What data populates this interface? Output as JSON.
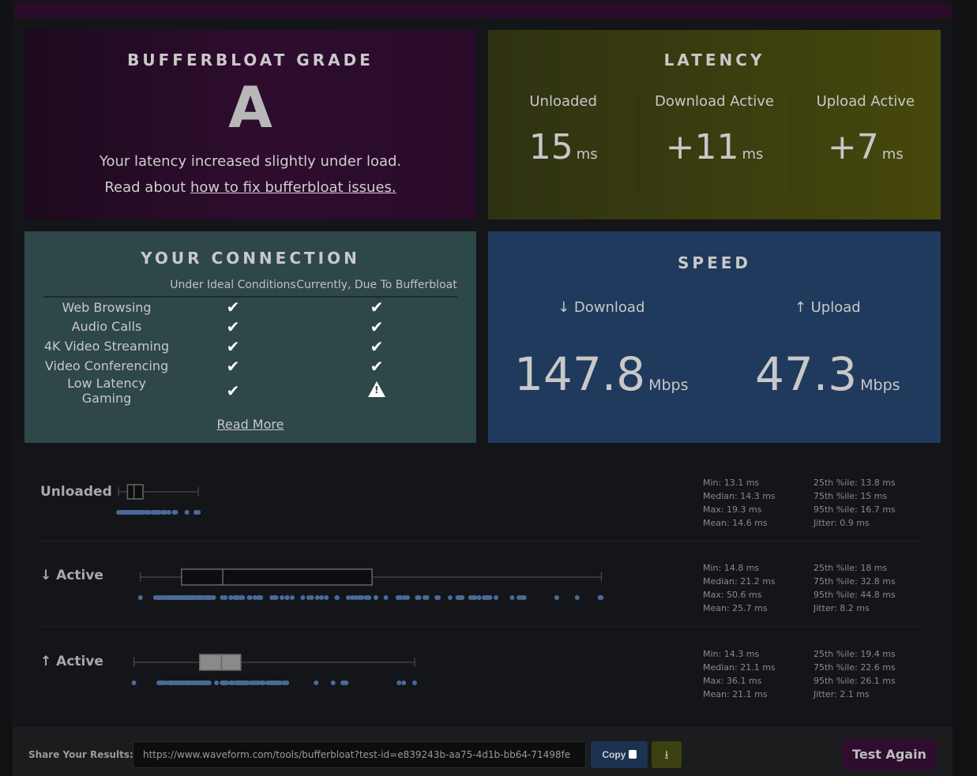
{
  "grade": {
    "title": "BUFFERBLOAT GRADE",
    "letter": "A",
    "line1": "Your latency increased slightly under load.",
    "line2_prefix": "Read about ",
    "link": "how to fix bufferbloat issues."
  },
  "latency": {
    "title": "LATENCY",
    "cols": [
      {
        "label": "Unloaded",
        "value": "15",
        "unit": "ms"
      },
      {
        "label": "Download Active",
        "value": "+11",
        "unit": "ms"
      },
      {
        "label": "Upload Active",
        "value": "+7",
        "unit": "ms"
      }
    ]
  },
  "connection": {
    "title": "YOUR CONNECTION",
    "col1": "Under Ideal Conditions",
    "col2": "Currently, Due To Bufferbloat",
    "rows": [
      {
        "name": "Web Browsing",
        "ideal": "ok",
        "current": "ok"
      },
      {
        "name": "Audio Calls",
        "ideal": "ok",
        "current": "ok"
      },
      {
        "name": "4K Video Streaming",
        "ideal": "ok",
        "current": "ok"
      },
      {
        "name": "Video Conferencing",
        "ideal": "ok",
        "current": "ok"
      },
      {
        "name": "Low Latency Gaming",
        "ideal": "ok",
        "current": "warning"
      }
    ],
    "read_more": "Read More"
  },
  "speed": {
    "title": "SPEED",
    "download_label": "↓ Download",
    "download": "147.8",
    "upload_label": "↑ Upload",
    "upload": "47.3",
    "unit": "Mbps"
  },
  "latency_rows": [
    {
      "label": "Unloaded",
      "min": 13.1,
      "median": 14.3,
      "max": 19.3,
      "mean": 14.6,
      "p25": 13.8,
      "p75": 15,
      "p95": 16.7,
      "jitter": 0.9,
      "s": [
        "Min: 13.1 ms",
        "Median: 14.3 ms",
        "Max: 19.3 ms",
        "Mean: 14.6 ms",
        "25th %ile: 13.8 ms",
        "75th %ile: 15 ms",
        "95th %ile: 16.7 ms",
        "Jitter: 0.9 ms"
      ]
    },
    {
      "label": "↓ Active",
      "min": 14.8,
      "median": 21.2,
      "max": 50.6,
      "mean": 25.7,
      "p25": 18,
      "p75": 32.8,
      "p95": 44.8,
      "jitter": 8.2,
      "s": [
        "Min: 14.8 ms",
        "Median: 21.2 ms",
        "Max: 50.6 ms",
        "Mean: 25.7 ms",
        "25th %ile: 18 ms",
        "75th %ile: 32.8 ms",
        "95th %ile: 44.8 ms",
        "Jitter: 8.2 ms"
      ]
    },
    {
      "label": "↑ Active",
      "min": 14.3,
      "median": 21.1,
      "max": 36.1,
      "mean": 21.1,
      "p25": 19.4,
      "p75": 22.6,
      "p95": 26.1,
      "jitter": 2.1,
      "s": [
        "Min: 14.3 ms",
        "Median: 21.1 ms",
        "Max: 36.1 ms",
        "Mean: 21.1 ms",
        "25th %ile: 19.4 ms",
        "75th %ile: 22.6 ms",
        "95th %ile: 26.1 ms",
        "Jitter: 2.1 ms"
      ]
    }
  ],
  "footer": {
    "share_label": "Share Your Results:",
    "share_url": "https://www.waveform.com/tools/bufferbloat?test-id=e839243b-aa75-4d1b-bb64-71498fe",
    "copy": "Copy",
    "test_again": "Test Again"
  },
  "colors": {
    "dot": "#4a6a9a",
    "box_fill_upload": "#8a8a8a"
  }
}
